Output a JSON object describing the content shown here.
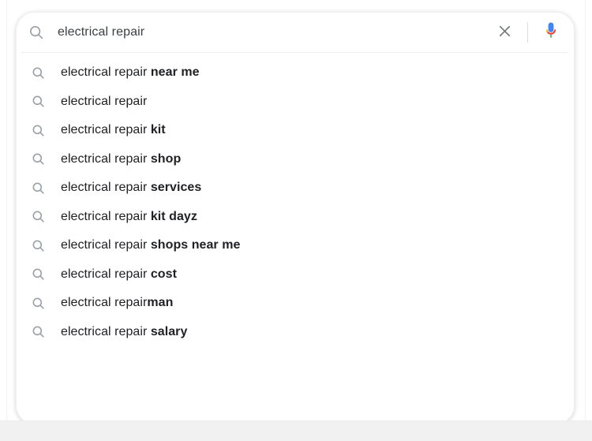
{
  "search_box": {
    "search_icon": "search-icon",
    "query": "electrical repair",
    "placeholder": "Search",
    "clear_icon": "close-icon",
    "clear_label": "Clear",
    "mic_icon": "microphone-icon",
    "mic_label": "Search by voice",
    "colors": {
      "icon_gray": "#9aa0a6",
      "text": "#3c4043",
      "divider": "#dadce0",
      "mic_blue": "#4285f4",
      "mic_red": "#ea4335",
      "mic_yellow": "#fbbc05",
      "mic_green": "#34a853"
    }
  },
  "suggestions": {
    "row_icon": "search-icon",
    "items": [
      {
        "prefix": "electrical repair ",
        "completion": "near me"
      },
      {
        "prefix": "electrical repair",
        "completion": ""
      },
      {
        "prefix": "electrical repair ",
        "completion": "kit"
      },
      {
        "prefix": "electrical repair ",
        "completion": "shop"
      },
      {
        "prefix": "electrical repair ",
        "completion": "services"
      },
      {
        "prefix": "electrical repair ",
        "completion": "kit dayz"
      },
      {
        "prefix": "electrical repair ",
        "completion": "shops near me"
      },
      {
        "prefix": "electrical repair ",
        "completion": "cost"
      },
      {
        "prefix": "electrical repair",
        "completion": "man"
      },
      {
        "prefix": "electrical repair ",
        "completion": "salary"
      }
    ]
  },
  "page": {
    "background": "#ffffff",
    "bottom_strip_color": "#f1f1f1",
    "card_background": "#ffffff"
  }
}
